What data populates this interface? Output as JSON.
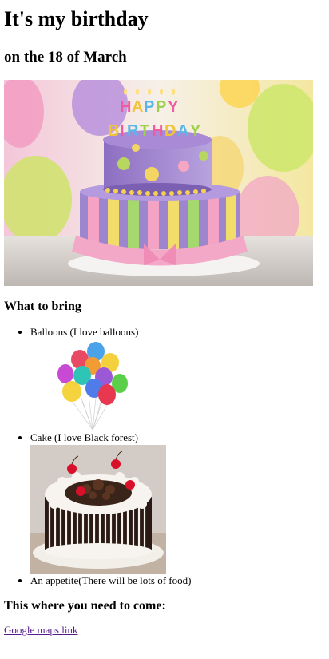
{
  "page": {
    "title": "It's my birthday",
    "subtitle": "on the 18 of March",
    "hero_image": "birthday-cake-photo",
    "bring_heading": "What to bring",
    "items": [
      {
        "label": "Balloons (I love balloons)",
        "image": "balloons-photo"
      },
      {
        "label": "Cake (I love Black forest)",
        "image": "black-forest-cake-photo"
      },
      {
        "label": "An appetite(There will be lots of food)"
      }
    ],
    "where_heading": "This where you need to come:",
    "map_link_text": "Google maps link"
  },
  "colors": {
    "link": "#551a8b",
    "text": "#000000",
    "background": "#ffffff"
  }
}
